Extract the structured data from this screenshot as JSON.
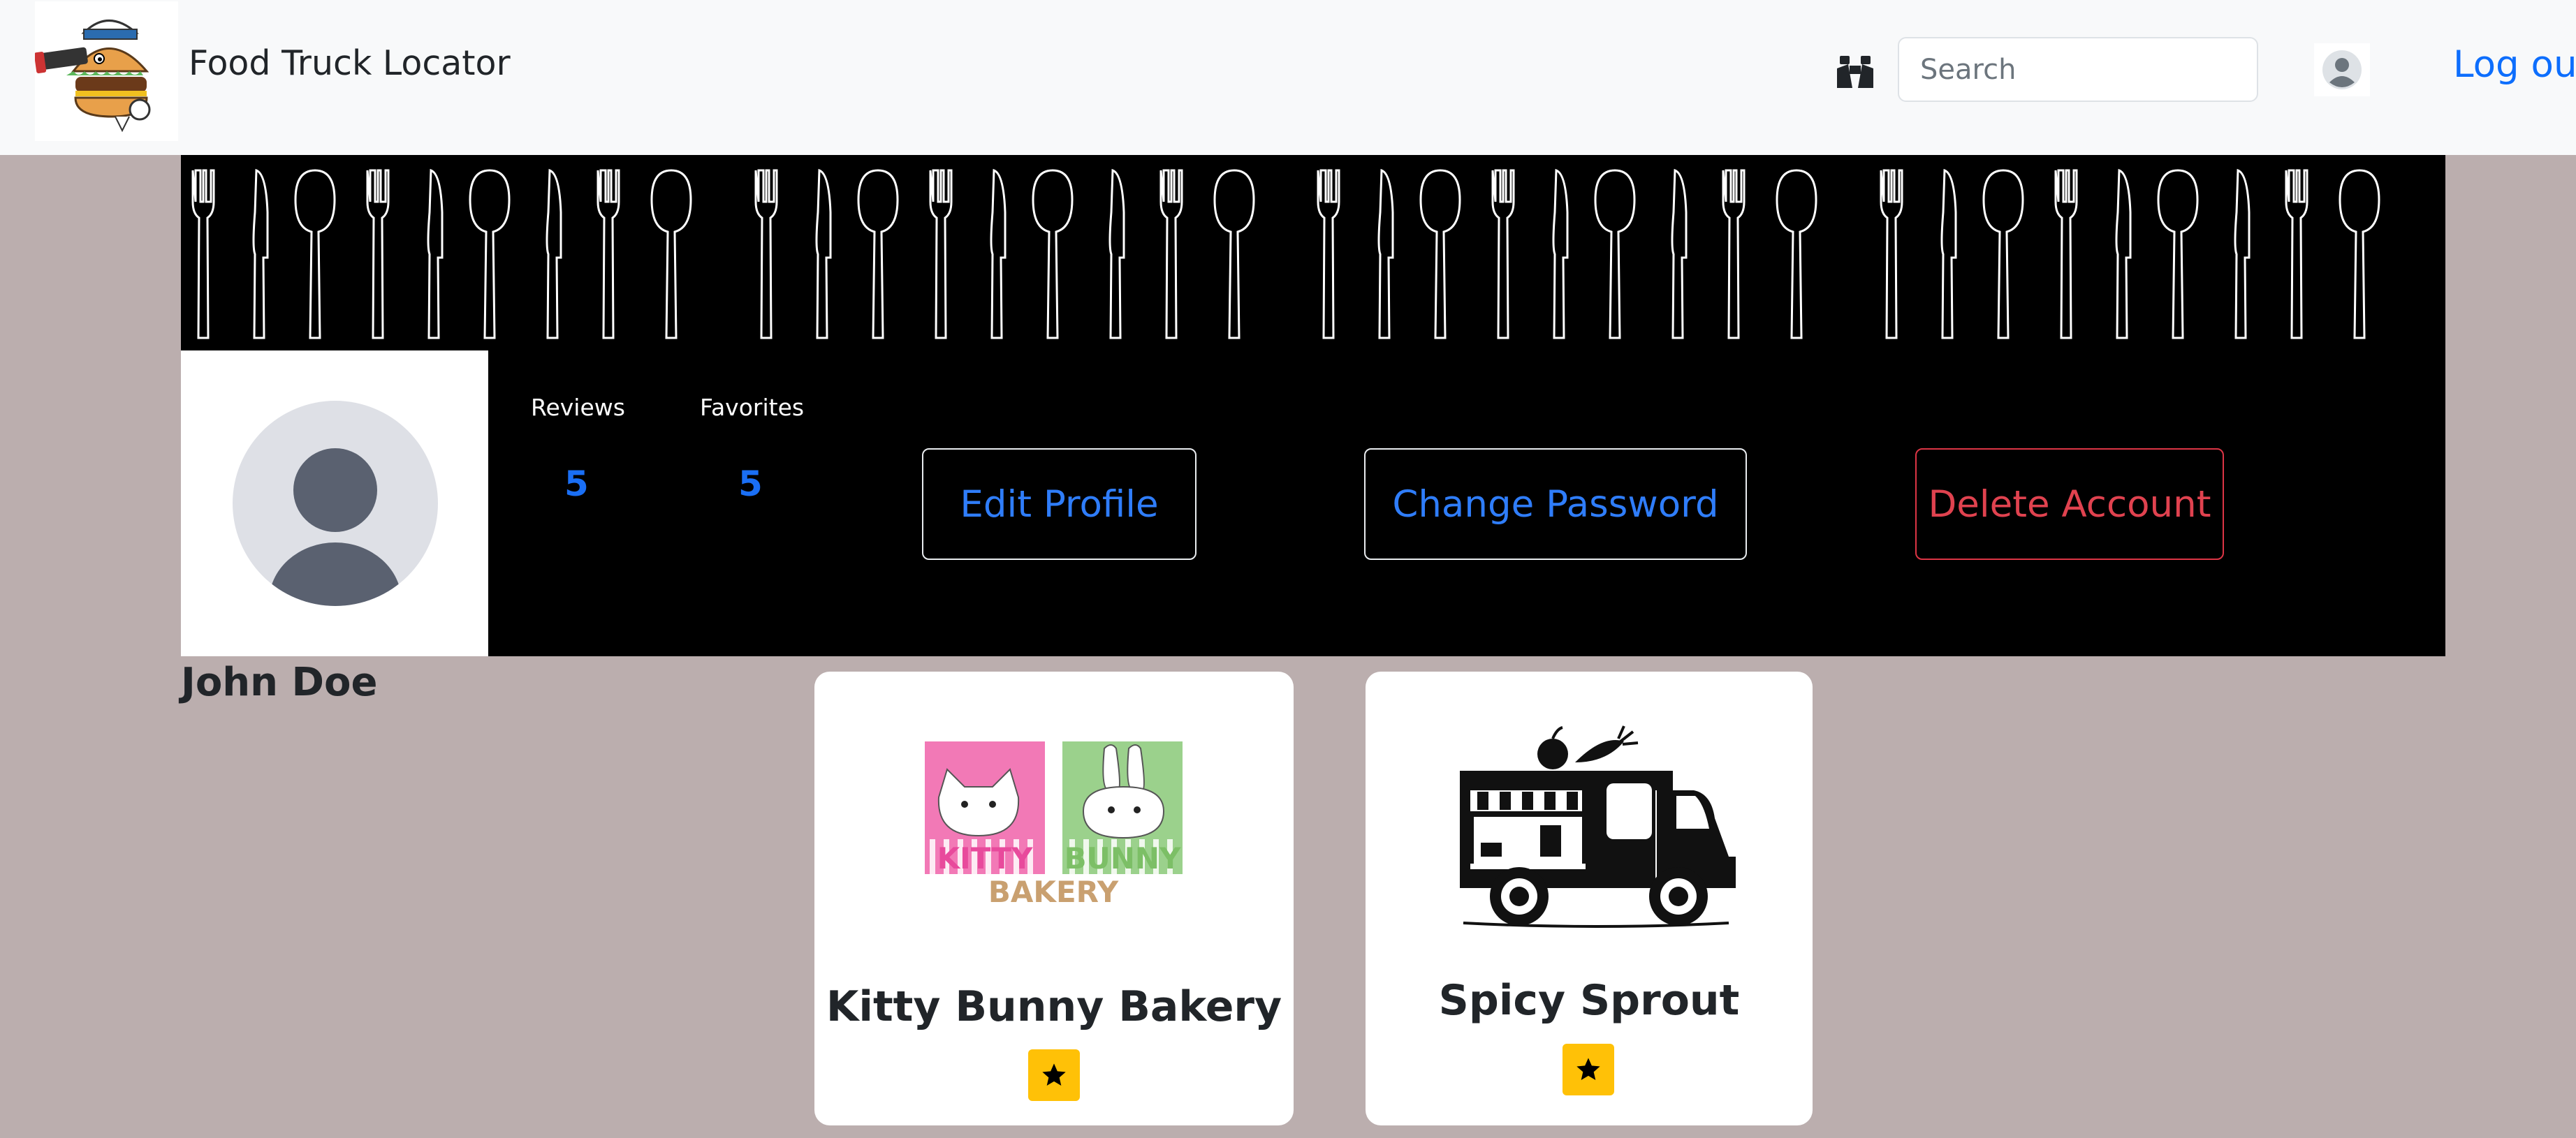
{
  "navbar": {
    "brand": "Food Truck Locator",
    "search_placeholder": "Search",
    "logout_label": "Log out"
  },
  "profile": {
    "stats": [
      {
        "label": "Reviews",
        "value": "5"
      },
      {
        "label": "Favorites",
        "value": "5"
      }
    ],
    "buttons": {
      "edit": "Edit Profile",
      "change_password": "Change Password",
      "delete": "Delete Account"
    },
    "name": "John Doe"
  },
  "favorites": [
    {
      "name": "Kitty Bunny Bakery",
      "logo_text_1": "KITTY",
      "logo_text_2": "BUNNY",
      "logo_text_3": "BAKERY"
    },
    {
      "name": "Spicy Sprout"
    }
  ],
  "colors": {
    "accent": "#0d6efd",
    "danger": "#dc3545",
    "page_bg": "#bbaeae",
    "favorite_badge": "#ffc107"
  }
}
